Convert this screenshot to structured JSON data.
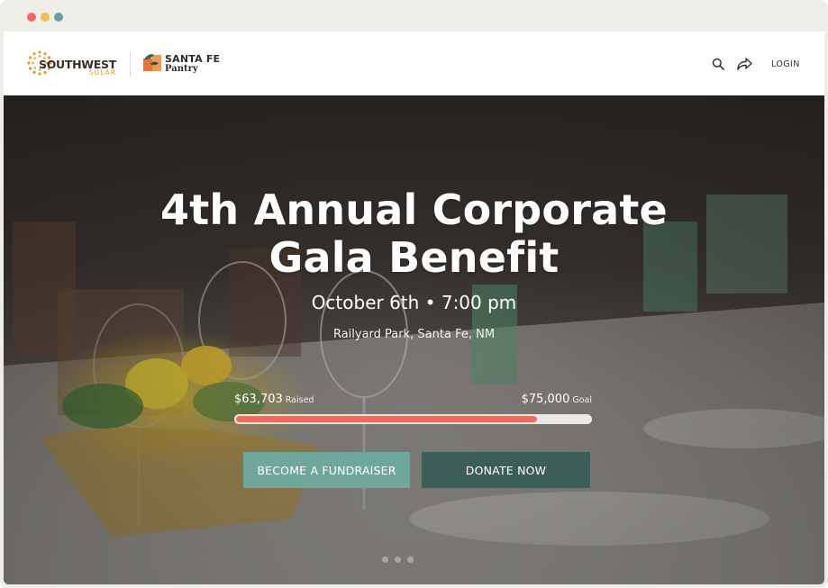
{
  "window": {
    "controls": [
      "close",
      "minimize",
      "maximize"
    ]
  },
  "header": {
    "logo_southwest": {
      "name": "SOUTHWEST",
      "sub": "SOLAR"
    },
    "logo_santafe": {
      "line1": "SANTA FE",
      "line2": "Pantry"
    },
    "icons": [
      "search-icon",
      "share-icon"
    ],
    "login_label": "LOGIN"
  },
  "hero": {
    "title_line1": "4th Annual Corporate",
    "title_line2": "Gala Benefit",
    "date": "October 6th • 7:00 pm",
    "location": "Railyard Park, Santa Fe, NM",
    "raised_amount": "$63,703",
    "raised_label": "Raised",
    "goal_amount": "$75,000",
    "goal_label": "Goal",
    "progress_fraction": 0.8494,
    "buttons": {
      "fundraiser": "BECOME A FUNDRAISER",
      "donate": "DONATE NOW"
    }
  },
  "colors": {
    "accent_progress": "#ec6d5b",
    "button_primary": "#6fa79c",
    "button_secondary": "#3d5e57",
    "brand_orange": "#e89b2a"
  }
}
